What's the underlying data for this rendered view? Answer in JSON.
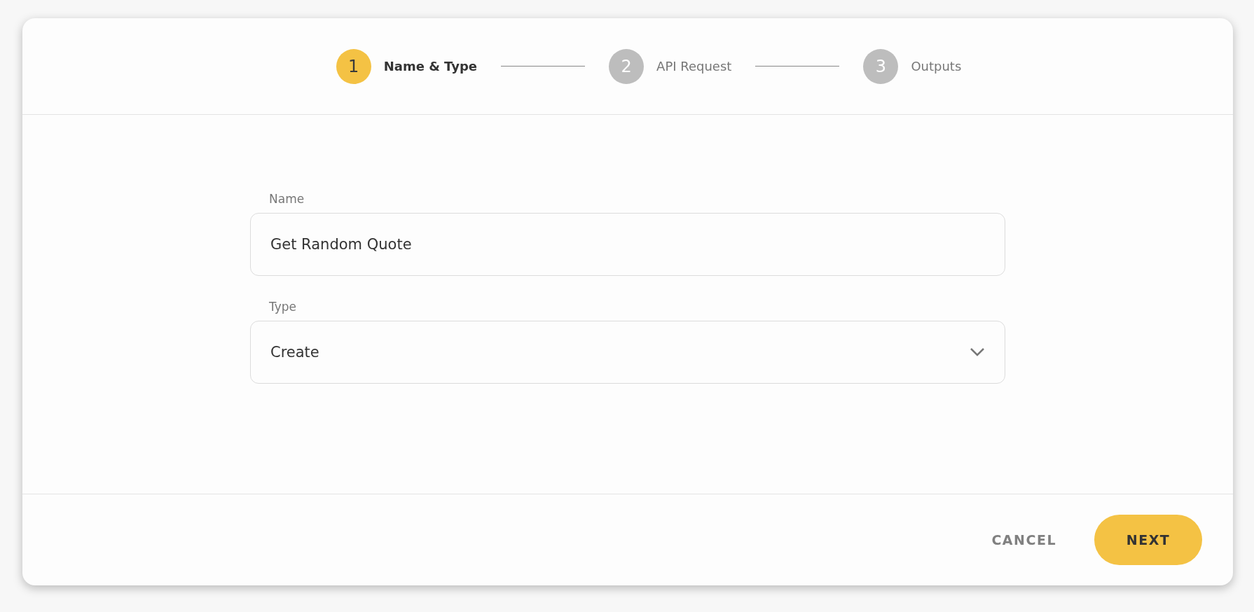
{
  "steps": [
    {
      "number": "1",
      "label": "Name & Type",
      "selected": true
    },
    {
      "number": "2",
      "label": "API Request",
      "selected": false
    },
    {
      "number": "3",
      "label": "Outputs",
      "selected": false
    }
  ],
  "fields": [
    {
      "kind": "text",
      "label": "Name",
      "value": "Get Random Quote"
    },
    {
      "kind": "select",
      "label": "Type",
      "value": "Create"
    }
  ],
  "buttons": [
    {
      "kind": "text",
      "label": "CANCEL"
    },
    {
      "kind": "primary",
      "label": "NEXT"
    }
  ]
}
